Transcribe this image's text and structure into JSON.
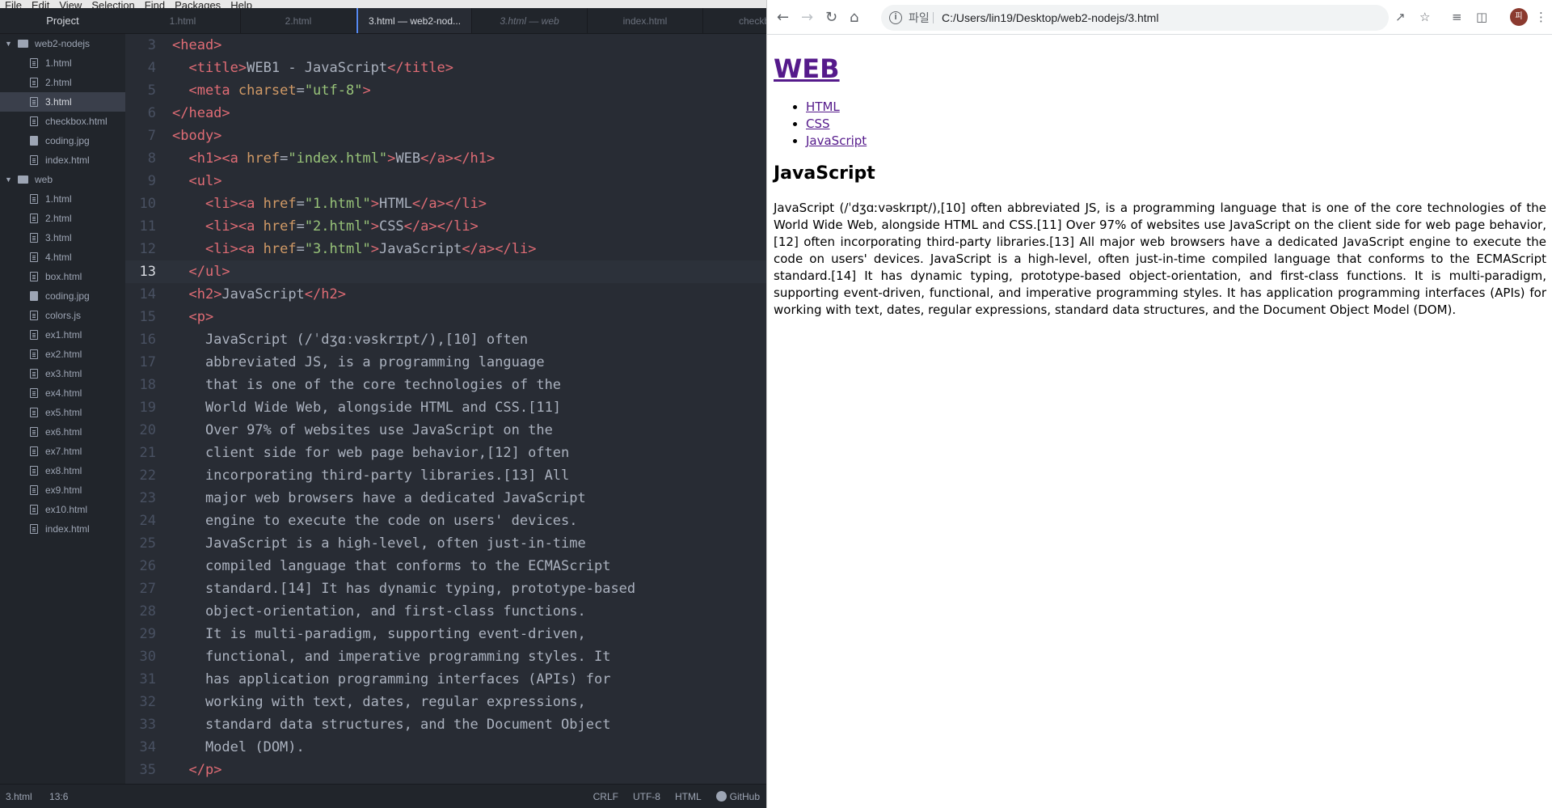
{
  "editor": {
    "menu": [
      "File",
      "Edit",
      "View",
      "Selection",
      "Find",
      "Packages",
      "Help"
    ],
    "tree_header": "Project",
    "folders": [
      {
        "name": "web2-nodejs",
        "files": [
          {
            "name": "1.html",
            "type": "file"
          },
          {
            "name": "2.html",
            "type": "file"
          },
          {
            "name": "3.html",
            "type": "file",
            "selected": true
          },
          {
            "name": "checkbox.html",
            "type": "file"
          },
          {
            "name": "coding.jpg",
            "type": "image"
          },
          {
            "name": "index.html",
            "type": "file"
          }
        ]
      },
      {
        "name": "web",
        "files": [
          {
            "name": "1.html",
            "type": "file"
          },
          {
            "name": "2.html",
            "type": "file"
          },
          {
            "name": "3.html",
            "type": "file"
          },
          {
            "name": "4.html",
            "type": "file"
          },
          {
            "name": "box.html",
            "type": "file"
          },
          {
            "name": "coding.jpg",
            "type": "image"
          },
          {
            "name": "colors.js",
            "type": "file"
          },
          {
            "name": "ex1.html",
            "type": "file"
          },
          {
            "name": "ex2.html",
            "type": "file"
          },
          {
            "name": "ex3.html",
            "type": "file"
          },
          {
            "name": "ex4.html",
            "type": "file"
          },
          {
            "name": "ex5.html",
            "type": "file"
          },
          {
            "name": "ex6.html",
            "type": "file"
          },
          {
            "name": "ex7.html",
            "type": "file"
          },
          {
            "name": "ex8.html",
            "type": "file"
          },
          {
            "name": "ex9.html",
            "type": "file"
          },
          {
            "name": "ex10.html",
            "type": "file"
          },
          {
            "name": "index.html",
            "type": "file"
          }
        ]
      }
    ],
    "tabs": [
      {
        "label": "1.html"
      },
      {
        "label": "2.html"
      },
      {
        "label": "3.html — web2-nod...",
        "active": true
      },
      {
        "label": "3.html — web",
        "italic": true
      },
      {
        "label": "index.html"
      },
      {
        "label": "checkbox."
      }
    ],
    "code_lines": [
      {
        "n": "3",
        "tokens": [
          [
            "t",
            "<head>"
          ]
        ]
      },
      {
        "n": "4",
        "tokens": [
          [
            "p",
            "  "
          ],
          [
            "t",
            "<title>"
          ],
          [
            "p",
            "WEB1 - JavaScript"
          ],
          [
            "t",
            "</title>"
          ]
        ]
      },
      {
        "n": "5",
        "tokens": [
          [
            "p",
            "  "
          ],
          [
            "t",
            "<meta "
          ],
          [
            "a",
            "charset"
          ],
          [
            "p",
            "="
          ],
          [
            "s",
            "\"utf-8\""
          ],
          [
            "t",
            ">"
          ]
        ]
      },
      {
        "n": "6",
        "tokens": [
          [
            "t",
            "</head>"
          ]
        ]
      },
      {
        "n": "7",
        "tokens": [
          [
            "t",
            "<body>"
          ]
        ]
      },
      {
        "n": "8",
        "tokens": [
          [
            "p",
            "  "
          ],
          [
            "t",
            "<h1><a "
          ],
          [
            "a",
            "href"
          ],
          [
            "p",
            "="
          ],
          [
            "s",
            "\"index.html\""
          ],
          [
            "t",
            ">"
          ],
          [
            "p",
            "WEB"
          ],
          [
            "t",
            "</a></h1>"
          ]
        ]
      },
      {
        "n": "9",
        "tokens": [
          [
            "p",
            "  "
          ],
          [
            "t",
            "<ul>"
          ]
        ]
      },
      {
        "n": "10",
        "tokens": [
          [
            "p",
            "    "
          ],
          [
            "t",
            "<li><a "
          ],
          [
            "a",
            "href"
          ],
          [
            "p",
            "="
          ],
          [
            "s",
            "\"1.html\""
          ],
          [
            "t",
            ">"
          ],
          [
            "p",
            "HTML"
          ],
          [
            "t",
            "</a></li>"
          ]
        ]
      },
      {
        "n": "11",
        "tokens": [
          [
            "p",
            "    "
          ],
          [
            "t",
            "<li><a "
          ],
          [
            "a",
            "href"
          ],
          [
            "p",
            "="
          ],
          [
            "s",
            "\"2.html\""
          ],
          [
            "t",
            ">"
          ],
          [
            "p",
            "CSS"
          ],
          [
            "t",
            "</a></li>"
          ]
        ]
      },
      {
        "n": "12",
        "tokens": [
          [
            "p",
            "    "
          ],
          [
            "t",
            "<li><a "
          ],
          [
            "a",
            "href"
          ],
          [
            "p",
            "="
          ],
          [
            "s",
            "\"3.html\""
          ],
          [
            "t",
            ">"
          ],
          [
            "p",
            "JavaScript"
          ],
          [
            "t",
            "</a></li>"
          ]
        ]
      },
      {
        "n": "13",
        "tokens": [
          [
            "p",
            "  "
          ],
          [
            "t",
            "</ul>"
          ]
        ],
        "current": true
      },
      {
        "n": "14",
        "tokens": [
          [
            "p",
            "  "
          ],
          [
            "t",
            "<h2>"
          ],
          [
            "p",
            "JavaScript"
          ],
          [
            "t",
            "</h2>"
          ]
        ]
      },
      {
        "n": "15",
        "tokens": [
          [
            "p",
            "  "
          ],
          [
            "t",
            "<p>"
          ]
        ]
      },
      {
        "n": "16",
        "tokens": [
          [
            "p",
            "    JavaScript (/ˈdʒɑːvəskrɪpt/),[10] often"
          ]
        ]
      },
      {
        "n": "17",
        "tokens": [
          [
            "p",
            "    abbreviated JS, is a programming language"
          ]
        ]
      },
      {
        "n": "18",
        "tokens": [
          [
            "p",
            "    that is one of the core technologies of the"
          ]
        ]
      },
      {
        "n": "19",
        "tokens": [
          [
            "p",
            "    World Wide Web, alongside HTML and CSS.[11]"
          ]
        ]
      },
      {
        "n": "20",
        "tokens": [
          [
            "p",
            "    Over 97% of websites use JavaScript on the"
          ]
        ]
      },
      {
        "n": "21",
        "tokens": [
          [
            "p",
            "    client side for web page behavior,[12] often"
          ]
        ]
      },
      {
        "n": "22",
        "tokens": [
          [
            "p",
            "    incorporating third-party libraries.[13] All"
          ]
        ]
      },
      {
        "n": "23",
        "tokens": [
          [
            "p",
            "    major web browsers have a dedicated JavaScript"
          ]
        ]
      },
      {
        "n": "24",
        "tokens": [
          [
            "p",
            "    engine to execute the code on users' devices."
          ]
        ]
      },
      {
        "n": "25",
        "tokens": [
          [
            "p",
            "    JavaScript is a high-level, often just-in-time"
          ]
        ]
      },
      {
        "n": "26",
        "tokens": [
          [
            "p",
            "    compiled language that conforms to the ECMAScript"
          ]
        ]
      },
      {
        "n": "27",
        "tokens": [
          [
            "p",
            "    standard.[14] It has dynamic typing, prototype-based"
          ]
        ]
      },
      {
        "n": "28",
        "tokens": [
          [
            "p",
            "    object-orientation, and first-class functions."
          ]
        ]
      },
      {
        "n": "29",
        "tokens": [
          [
            "p",
            "    It is multi-paradigm, supporting event-driven,"
          ]
        ]
      },
      {
        "n": "30",
        "tokens": [
          [
            "p",
            "    functional, and imperative programming styles. It"
          ]
        ]
      },
      {
        "n": "31",
        "tokens": [
          [
            "p",
            "    has application programming interfaces (APIs) for"
          ]
        ]
      },
      {
        "n": "32",
        "tokens": [
          [
            "p",
            "    working with text, dates, regular expressions,"
          ]
        ]
      },
      {
        "n": "33",
        "tokens": [
          [
            "p",
            "    standard data structures, and the Document Object"
          ]
        ]
      },
      {
        "n": "34",
        "tokens": [
          [
            "p",
            "    Model (DOM)."
          ]
        ]
      },
      {
        "n": "35",
        "tokens": [
          [
            "p",
            "  "
          ],
          [
            "t",
            "</p>"
          ]
        ]
      }
    ],
    "status": {
      "file": "3.html",
      "cursor": "13:6",
      "line_ending": "CRLF",
      "encoding": "UTF-8",
      "grammar": "HTML",
      "github": "GitHub"
    },
    "colors": {
      "tag": "#e06c75",
      "attr": "#d19a66",
      "string": "#98c379",
      "text": "#abb2bf",
      "background": "#282c34"
    }
  },
  "browser": {
    "scheme_label": "파일",
    "url": "C:/Users/lin19/Desktop/web2-nodejs/3.html",
    "avatar_initial": "피",
    "page": {
      "h1_link": "WEB",
      "links": [
        "HTML",
        "CSS",
        "JavaScript"
      ],
      "h2": "JavaScript",
      "paragraph": "JavaScript (/ˈdʒɑːvəskrɪpt/),[10] often abbreviated JS, is a programming language that is one of the core technologies of the World Wide Web, alongside HTML and CSS.[11] Over 97% of websites use JavaScript on the client side for web page behavior,[12] often incorporating third-party libraries.[13] All major web browsers have a dedicated JavaScript engine to execute the code on users' devices. JavaScript is a high-level, often just-in-time compiled language that conforms to the ECMAScript standard.[14] It has dynamic typing, prototype-based object-orientation, and first-class functions. It is multi-paradigm, supporting event-driven, functional, and imperative programming styles. It has application programming interfaces (APIs) for working with text, dates, regular expressions, standard data structures, and the Document Object Model (DOM)."
    }
  }
}
